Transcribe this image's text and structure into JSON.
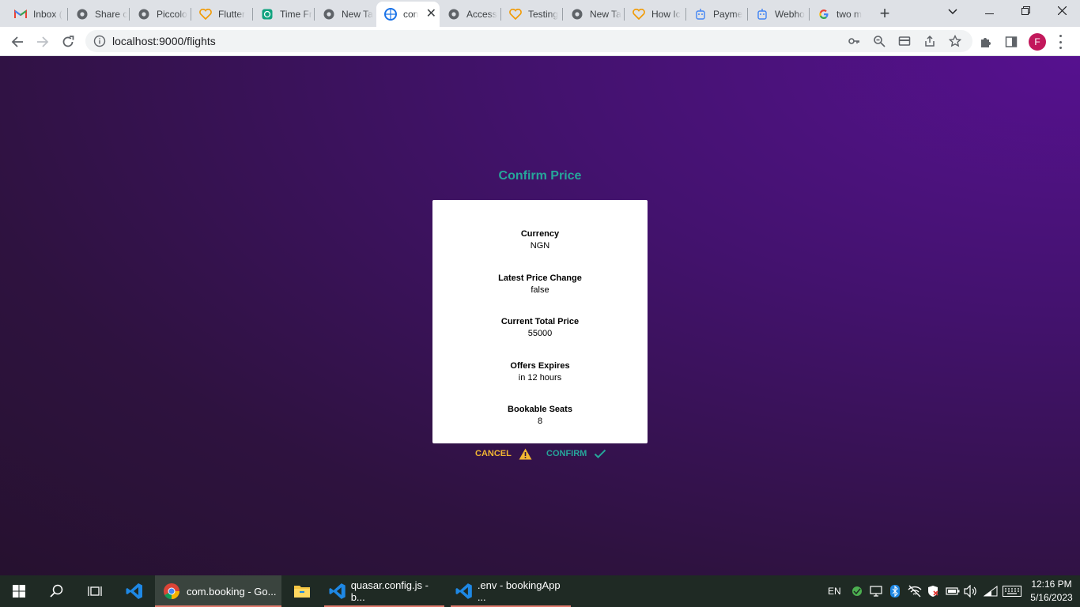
{
  "browser": {
    "tabs": [
      {
        "title": "Inbox (",
        "icon": "gmail-icon",
        "active": false
      },
      {
        "title": "Share c",
        "icon": "chrome-icon",
        "active": false
      },
      {
        "title": "Piccolo",
        "icon": "chrome-icon",
        "active": false
      },
      {
        "title": "Flutter",
        "icon": "heart-icon",
        "active": false
      },
      {
        "title": "Time Fr",
        "icon": "chatgpt-icon",
        "active": false
      },
      {
        "title": "New Ta",
        "icon": "chrome-icon",
        "active": false
      },
      {
        "title": "con",
        "icon": "app-icon",
        "active": true
      },
      {
        "title": "Access",
        "icon": "chrome-icon",
        "active": false
      },
      {
        "title": "Testing",
        "icon": "heart-icon",
        "active": false
      },
      {
        "title": "New Ta",
        "icon": "chrome-icon",
        "active": false
      },
      {
        "title": "How Ic",
        "icon": "heart-icon",
        "active": false
      },
      {
        "title": "Payme",
        "icon": "robot-icon",
        "active": false
      },
      {
        "title": "Webho",
        "icon": "robot-icon",
        "active": false
      },
      {
        "title": "two m",
        "icon": "google-icon",
        "active": false
      }
    ],
    "url": "localhost:9000/flights",
    "profile_initial": "F"
  },
  "dialog": {
    "title": "Confirm Price",
    "fields": [
      {
        "label": "Currency",
        "value": "NGN"
      },
      {
        "label": "Latest Price Change",
        "value": "false"
      },
      {
        "label": "Current Total Price",
        "value": "55000"
      },
      {
        "label": "Offers Expires",
        "value": "in 12 hours"
      },
      {
        "label": "Bookable Seats",
        "value": "8"
      }
    ],
    "cancel_label": "CANCEL",
    "confirm_label": "CONFIRM"
  },
  "colors": {
    "accent_teal": "#26a69a",
    "warning_yellow": "#f2b632",
    "page_bg_top": "#56118f",
    "page_bg_bottom": "#26112f"
  },
  "taskbar": {
    "apps": [
      {
        "title": "",
        "icon": "vscode-icon"
      },
      {
        "title": "com.booking - Go...",
        "icon": "chrome-icon"
      },
      {
        "title": "",
        "icon": "file-explorer-icon"
      },
      {
        "title": "quasar.config.js - b...",
        "icon": "vscode-icon"
      },
      {
        "title": ".env - bookingApp ...",
        "icon": "vscode-icon"
      }
    ],
    "language": "EN",
    "time": "12:16 PM",
    "date": "5/16/2023"
  }
}
